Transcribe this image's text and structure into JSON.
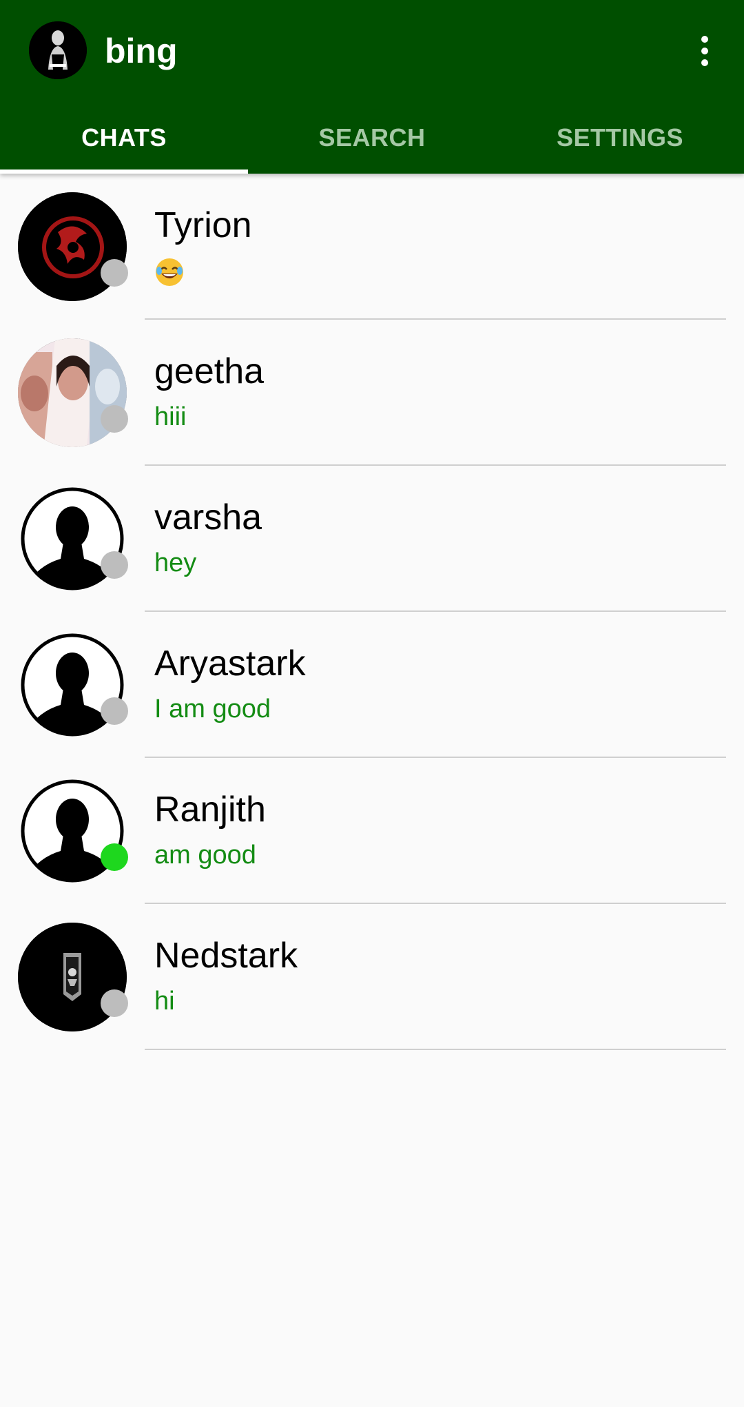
{
  "app": {
    "title": "bing",
    "menu_icon": "more-vert-icon",
    "avatar_icon": "profile-avatar"
  },
  "tabs": [
    {
      "label": "CHATS",
      "active": true
    },
    {
      "label": "SEARCH",
      "active": false
    },
    {
      "label": "SETTINGS",
      "active": false
    }
  ],
  "colors": {
    "appbar": "#004f00",
    "message_text": "#148c14",
    "online": "#1ed71e",
    "offline": "#bdbdbd",
    "inactive_tab": "#a5c8a5"
  },
  "chats": [
    {
      "name": "Tyrion",
      "last_message": "😂",
      "last_message_icon": "face-with-tears-of-joy-emoji",
      "status": "offline",
      "avatar": "dragon-sigil-avatar"
    },
    {
      "name": "geetha",
      "last_message": "hiii",
      "status": "offline",
      "avatar": "photo-collage-avatar"
    },
    {
      "name": "varsha",
      "last_message": "hey",
      "status": "offline",
      "avatar": "default-person-avatar"
    },
    {
      "name": "Aryastark",
      "last_message": "I am good",
      "status": "offline",
      "avatar": "default-person-avatar"
    },
    {
      "name": "Ranjith",
      "last_message": "am good",
      "status": "online",
      "avatar": "default-person-avatar"
    },
    {
      "name": "Nedstark",
      "last_message": "hi",
      "status": "offline",
      "avatar": "banner-avatar"
    }
  ]
}
